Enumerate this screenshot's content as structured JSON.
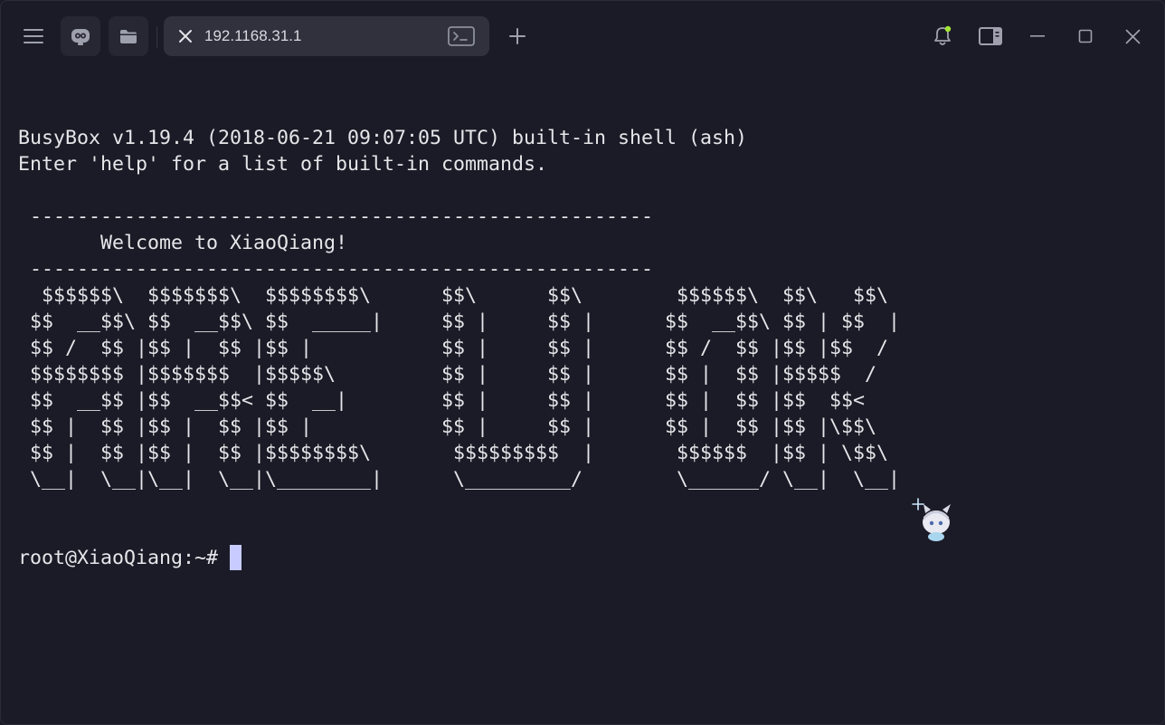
{
  "tab": {
    "title": "192.1168.31.1"
  },
  "terminal": {
    "lines": [
      "",
      "BusyBox v1.19.4 (2018-06-21 09:07:05 UTC) built-in shell (ash)",
      "Enter 'help' for a list of built-in commands.",
      "",
      " -----------------------------------------------------",
      "       Welcome to XiaoQiang!",
      " -----------------------------------------------------",
      "  $$$$$$\\  $$$$$$$\\  $$$$$$$$\\      $$\\      $$\\        $$$$$$\\  $$\\   $$\\",
      " $$  __$$\\ $$  __$$\\ $$  _____|     $$ |     $$ |      $$  __$$\\ $$ | $$  |",
      " $$ /  $$ |$$ |  $$ |$$ |           $$ |     $$ |      $$ /  $$ |$$ |$$  /",
      " $$$$$$$$ |$$$$$$$  |$$$$$\\         $$ |     $$ |      $$ |  $$ |$$$$$  /",
      " $$  __$$ |$$  __$$< $$  __|        $$ |     $$ |      $$ |  $$ |$$  $$<",
      " $$ |  $$ |$$ |  $$ |$$ |           $$ |     $$ |      $$ |  $$ |$$ |\\$$\\",
      " $$ |  $$ |$$ |  $$ |$$$$$$$$\\       $$$$$$$$$  |       $$$$$$  |$$ | \\$$\\",
      " \\__|  \\__|\\__|  \\__|\\________|      \\_________/        \\______/ \\__|  \\__|",
      "",
      ""
    ],
    "prompt": "root@XiaoQiang:~#"
  },
  "icons": {
    "menu": "hamburger-menu-icon",
    "ai": "robot-icon",
    "folder": "folder-icon",
    "tab_close": "close-icon",
    "tab_terminal": "terminal-icon",
    "new_tab": "plus-icon",
    "bell": "bell-icon",
    "panel": "sidebar-panel-icon",
    "minimize": "minimize-icon",
    "maximize": "maximize-icon",
    "close": "close-icon"
  },
  "colors": {
    "background": "#1a1b26",
    "text": "#e6e6ea",
    "cursor": "#c7cbff",
    "tab_bg": "#30313d",
    "notification_dot": "#a3e635"
  }
}
